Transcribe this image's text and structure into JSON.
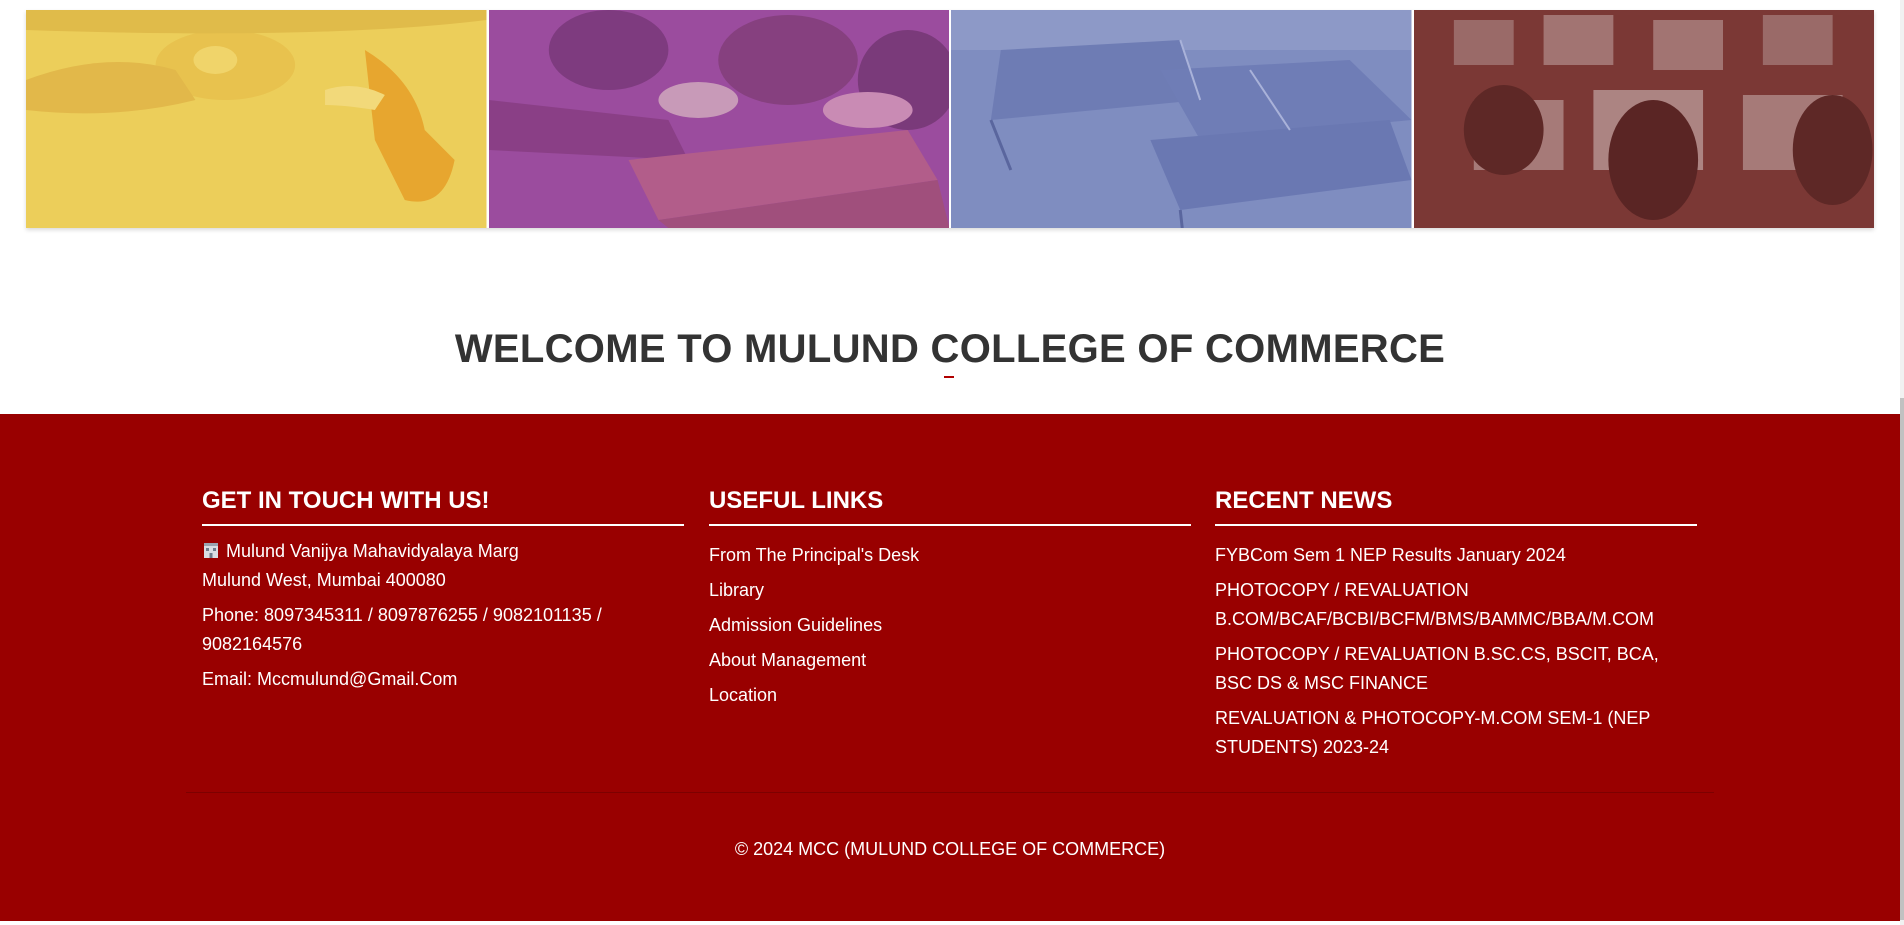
{
  "gallery": {
    "tiles": [
      {
        "name": "art-activity",
        "tint": "#eccb58"
      },
      {
        "name": "students-seated",
        "tint": "#9d4a9e"
      },
      {
        "name": "table-tennis",
        "tint": "#7d8bbf"
      },
      {
        "name": "computer-lab",
        "tint": "#7a3734"
      }
    ]
  },
  "welcome": {
    "title": "WELCOME TO MULUND COLLEGE OF COMMERCE"
  },
  "footer": {
    "background": "#990000",
    "contact": {
      "heading": "GET IN TOUCH WITH US!",
      "address_line1": "Mulund Vanijya Mahavidyalaya Marg",
      "address_line2": "Mulund West, Mumbai 400080",
      "phone": "Phone: 8097345311 / 8097876255 / 9082101135 / 9082164576",
      "email": "Email: Mccmulund@Gmail.Com",
      "address_icon": "building-icon"
    },
    "links": {
      "heading": "USEFUL LINKS",
      "items": [
        {
          "label": "From The Principal's Desk"
        },
        {
          "label": "Library"
        },
        {
          "label": "Admission Guidelines"
        },
        {
          "label": "About Management"
        },
        {
          "label": "Location"
        }
      ]
    },
    "news": {
      "heading": "RECENT NEWS",
      "items": [
        {
          "label": "FYBCom Sem 1 NEP Results January 2024"
        },
        {
          "label": "PHOTOCOPY / REVALUATION B.COM/BCAF/BCBI/BCFM/BMS/BAMMC/BBA/M.COM"
        },
        {
          "label": "PHOTOCOPY / REVALUATION B.SC.CS, BSCIT, BCA, BSC DS & MSC FINANCE"
        },
        {
          "label": "REVALUATION & PHOTOCOPY-M.COM SEM-1 (NEP STUDENTS) 2023-24"
        }
      ]
    },
    "copyright": "© 2024 MCC (MULUND COLLEGE OF COMMERCE)"
  }
}
